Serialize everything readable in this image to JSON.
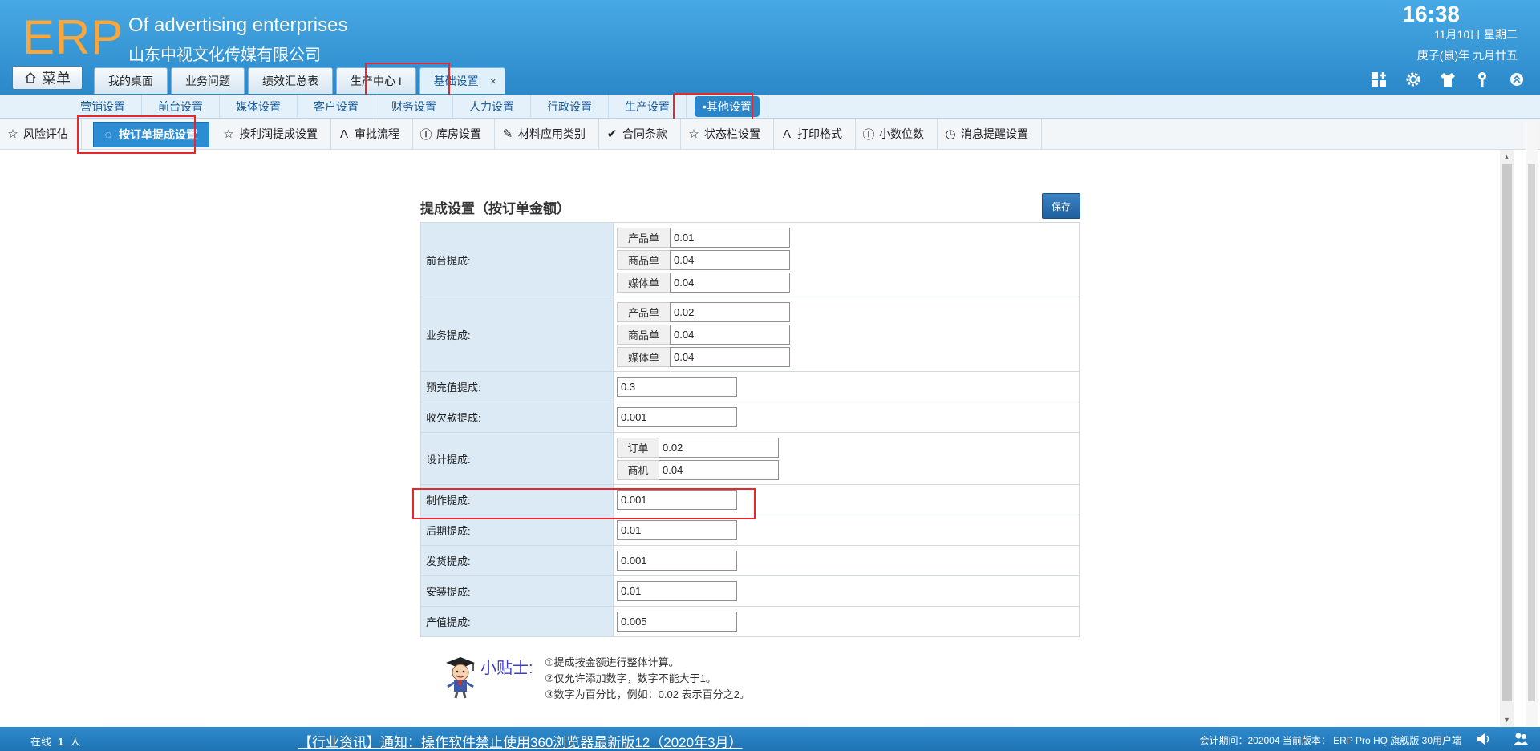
{
  "header": {
    "logo": "ERP",
    "company_en": "Of advertising enterprises",
    "company_cn": "山东中视文化传媒有限公司",
    "time": "16:38",
    "date": "11月10日 星期二",
    "lunar": "庚子(鼠)年 九月廿五",
    "menu_label": "菜单",
    "tabs": [
      {
        "label": "我的桌面"
      },
      {
        "label": "业务问题"
      },
      {
        "label": "绩效汇总表"
      },
      {
        "label": "生产中心 I"
      },
      {
        "label": "基础设置",
        "close": "×"
      }
    ],
    "icons": [
      "dashboard-add-icon",
      "gear-icon",
      "shirt-icon",
      "key-icon",
      "collapse-up-icon"
    ]
  },
  "subnav": {
    "items": [
      "营销设置",
      "前台设置",
      "媒体设置",
      "客户设置",
      "财务设置",
      "人力设置",
      "行政设置",
      "生产设置",
      "•其他设置"
    ]
  },
  "toolbar": {
    "items": [
      {
        "label": "风险评估",
        "icon": "☆"
      },
      {
        "label": "按订单提成设置",
        "icon": "◌"
      },
      {
        "label": "按利润提成设置",
        "icon": "☆"
      },
      {
        "label": "审批流程",
        "icon": "A"
      },
      {
        "label": "库房设置",
        "icon": "Ⓘ"
      },
      {
        "label": "材料应用类别",
        "icon": "✎"
      },
      {
        "label": "合同条款",
        "icon": "✔"
      },
      {
        "label": "状态栏设置",
        "icon": "☆"
      },
      {
        "label": "打印格式",
        "icon": "A"
      },
      {
        "label": "小数位数",
        "icon": "Ⓘ"
      },
      {
        "label": "消息提醒设置",
        "icon": "◷"
      }
    ]
  },
  "form": {
    "title": "提成设置（按订单金额）",
    "save_label": "保存",
    "front": {
      "label": "前台提成:",
      "rows": [
        {
          "prefix": "产品单",
          "value": "0.01"
        },
        {
          "prefix": "商品单",
          "value": "0.04"
        },
        {
          "prefix": "媒体单",
          "value": "0.04"
        }
      ]
    },
    "business": {
      "label": "业务提成:",
      "rows": [
        {
          "prefix": "产品单",
          "value": "0.02"
        },
        {
          "prefix": "商品单",
          "value": "0.04"
        },
        {
          "prefix": "媒体单",
          "value": "0.04"
        }
      ]
    },
    "prepaid": {
      "label": "预充值提成:",
      "value": "0.3"
    },
    "arrears": {
      "label": "收欠款提成:",
      "value": "0.001"
    },
    "design": {
      "label": "设计提成:",
      "rows": [
        {
          "prefix": "订单",
          "value": "0.02"
        },
        {
          "prefix": "商机",
          "value": "0.04"
        }
      ]
    },
    "production": {
      "label": "制作提成:",
      "value": "0.001"
    },
    "post": {
      "label": "后期提成:",
      "value": "0.01"
    },
    "delivery": {
      "label": "发货提成:",
      "value": "0.001"
    },
    "install": {
      "label": "安装提成:",
      "value": "0.01"
    },
    "output": {
      "label": "产值提成:",
      "value": "0.005"
    }
  },
  "tips": {
    "title": "小贴士:",
    "lines": [
      "①提成按金额进行整体计算。",
      "②仅允许添加数字，数字不能大于1。",
      "③数字为百分比，例如：0.02 表示百分之2。"
    ]
  },
  "footer": {
    "online_label": "在线",
    "online_count": "1",
    "online_unit": "人",
    "news": "【行业资讯】通知：操作软件禁止使用360浏览器最新版12（2020年3月）",
    "period": "会计期间：202004 当前版本：  ERP Pro HQ 旗舰版 30用户端",
    "icons": [
      "speaker-icon",
      "users-icon"
    ]
  },
  "colors": {
    "header_blue": "#2b88c9",
    "logo_orange": "#f7a73c",
    "highlight_red": "#e8262b",
    "label_bg": "#dceaf6",
    "tips_blue": "#3d3dcc"
  }
}
